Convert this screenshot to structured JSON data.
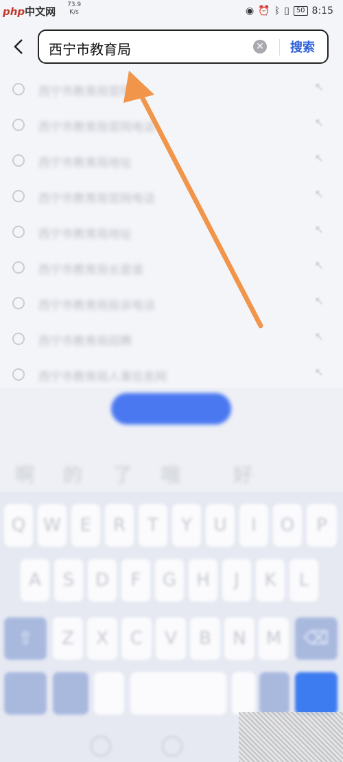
{
  "status_bar": {
    "site_logo": "php",
    "site_logo_cn": "中文网",
    "net_speed": "73.9",
    "net_speed_unit": "K/s",
    "battery": "50",
    "time": "8:15"
  },
  "search": {
    "query": "西宁市教育局",
    "button_label": "搜索"
  },
  "suggestions": [
    {
      "text": "西宁市教育局官网"
    },
    {
      "text": "西宁市教育局官网电话"
    },
    {
      "text": "西宁市教育局地址"
    },
    {
      "text": "西宁市教育局官网电话"
    },
    {
      "text": "西宁市教育局地址"
    },
    {
      "text": "西宁市教育局长是谁"
    },
    {
      "text": "西宁市教育局投诉电话"
    },
    {
      "text": "西宁市教育局招聘"
    },
    {
      "text": "西宁市教育局人事信息网"
    }
  ],
  "keyboard": {
    "candidates": [
      "啊",
      "的",
      "了",
      "哦",
      "好"
    ],
    "row1": [
      "Q",
      "W",
      "E",
      "R",
      "T",
      "Y",
      "U",
      "I",
      "O",
      "P"
    ],
    "row2": [
      "A",
      "S",
      "D",
      "F",
      "G",
      "H",
      "J",
      "K",
      "L"
    ],
    "row3": [
      "Z",
      "X",
      "C",
      "V",
      "B",
      "N",
      "M"
    ]
  },
  "annotation": {
    "arrow_color": "#f0954a"
  }
}
